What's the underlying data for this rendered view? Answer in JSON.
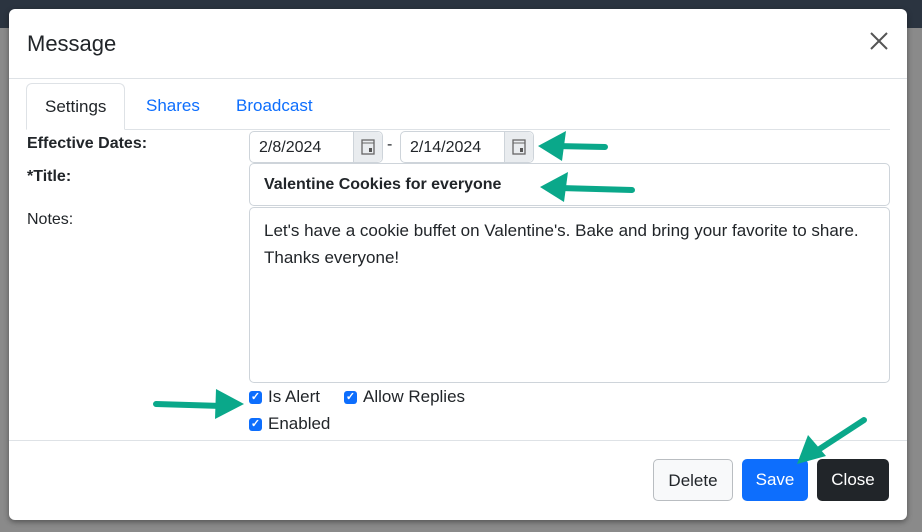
{
  "modal": {
    "title": "Message"
  },
  "tabs": [
    {
      "label": "Settings",
      "active": true
    },
    {
      "label": "Shares"
    },
    {
      "label": "Broadcast"
    }
  ],
  "form": {
    "effective_dates_label": "Effective Dates:",
    "start_date": "2/8/2024",
    "date_separator": "-",
    "end_date": "2/14/2024",
    "title_label": "*Title:",
    "title_value": "Valentine Cookies for everyone",
    "notes_label": "Notes:",
    "notes_value": "Let's have a cookie buffet on Valentine's. Bake and bring your favorite to share. Thanks everyone!",
    "checkboxes": [
      {
        "label": "Is Alert",
        "checked": true
      },
      {
        "label": "Allow Replies",
        "checked": true
      },
      {
        "label": "Enabled",
        "checked": true
      }
    ]
  },
  "footer": {
    "delete": "Delete",
    "save": "Save",
    "close": "Close"
  },
  "colors": {
    "primary": "#0d6efd",
    "dark": "#212529",
    "annotation_arrow": "#0aa88a"
  }
}
